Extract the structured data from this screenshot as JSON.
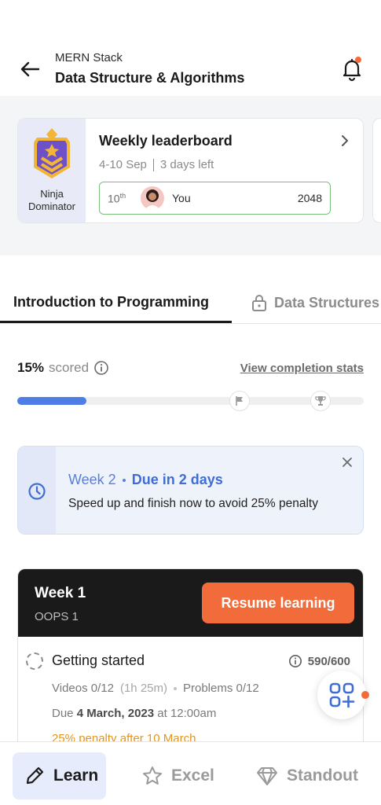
{
  "header": {
    "subtitle": "MERN Stack",
    "title": "Data Structure & Algorithms"
  },
  "leaderboard": {
    "badge_label": "Ninja Dominator",
    "title": "Weekly leaderboard",
    "date_range": "4-10 Sep",
    "time_left": "3 days left",
    "rank": "10",
    "rank_suffix": "th",
    "user_name": "You",
    "score": "2048"
  },
  "tabs": [
    {
      "label": "Introduction to Programming",
      "active": true
    },
    {
      "label": "Data Structures",
      "locked": true
    }
  ],
  "progress": {
    "percent_label": "15%",
    "scored_label": "scored",
    "stats_link": "View completion stats",
    "percent": 0.2,
    "milestone_icons": [
      "flag-icon",
      "trophy-icon"
    ]
  },
  "notice": {
    "week": "Week 2",
    "due": "Due in 2 days",
    "message": "Speed up and finish now to avoid 25% penalty"
  },
  "week_card": {
    "title": "Week 1",
    "subtitle": "OOPS 1",
    "resume_label": "Resume learning",
    "module": {
      "title": "Getting started",
      "points": "590/600",
      "videos": "Videos 0/12",
      "duration": "(1h 25m)",
      "problems": "Problems 0/12",
      "due_prefix": "Due",
      "due_date": "4 March, 2023",
      "due_suffix": "at 12:00am",
      "penalty": "25% penalty after 10 March"
    }
  },
  "bottom_nav": {
    "learn": "Learn",
    "excel": "Excel",
    "standout": "Standout"
  },
  "colors": {
    "accent_orange": "#f26b3a",
    "progress_blue": "#4f7de6",
    "notice_blue": "#3f6dd4",
    "rank_border_green": "#7bbf7b",
    "penalty_amber": "#e0951f"
  }
}
